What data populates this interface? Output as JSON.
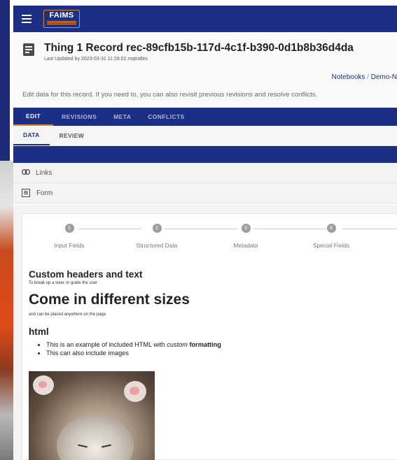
{
  "app": {
    "logo_text": "FAIMS",
    "brand_color": "#1c2f87",
    "accent_color": "#e3892e"
  },
  "record": {
    "title": "Thing 1 Record rec-89cfb15b-117d-4c1f-b390-0d1b8b36d4da",
    "updated": "Last Updated by 2023-03-31 11:28:02 mqtralles",
    "icon": "record-icon"
  },
  "breadcrumb": {
    "items": [
      "Notebooks",
      "Demo-N"
    ],
    "separator": "/"
  },
  "intro_text": "Edit data for this record. If you need to, you can also revisit previous revisions and resolve conflicts.",
  "tabs_main": [
    {
      "label": "EDIT",
      "active": true
    },
    {
      "label": "REVISIONS",
      "active": false
    },
    {
      "label": "META",
      "active": false
    },
    {
      "label": "CONFLICTS",
      "active": false
    }
  ],
  "tabs_sub": [
    {
      "label": "DATA",
      "active": true
    },
    {
      "label": "REVIEW",
      "active": false
    }
  ],
  "sections": {
    "links_label": "Links",
    "links_icon": "link-icon",
    "form_label": "Form",
    "form_icon": "form-icon"
  },
  "steps": [
    {
      "number": "1",
      "label": "Input Fields"
    },
    {
      "number": "2",
      "label": "Structured Data"
    },
    {
      "number": "3",
      "label": "Metadata"
    },
    {
      "number": "4",
      "label": "Special Fields"
    }
  ],
  "content": {
    "heading1": "Custom headers and text",
    "subtext1": "To break up a view, or guide the user",
    "heading2": "Come in different sizes",
    "subtext2": "and can be placed anywhere on the page",
    "heading3": "html",
    "bullet1_prefix": "This is an example of included HTML with ",
    "bullet1_em": "custom",
    "bullet1_bold": "formatting",
    "bullet2": "This can also include images",
    "image_subject": "kitten-image"
  }
}
